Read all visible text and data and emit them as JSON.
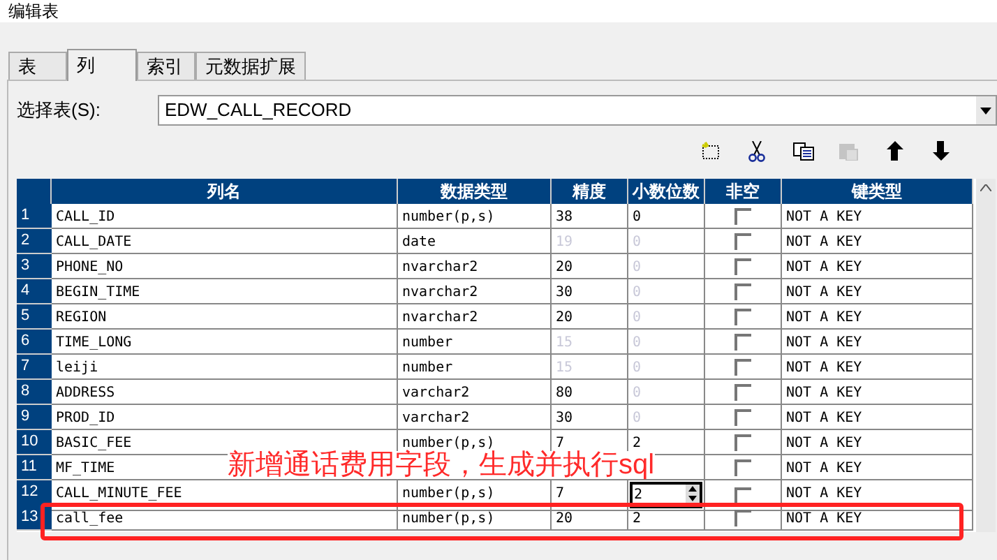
{
  "window": {
    "title": "编辑表"
  },
  "tabs": [
    {
      "label": "表",
      "selected": false
    },
    {
      "label": "列",
      "selected": true
    },
    {
      "label": "索引",
      "selected": false
    },
    {
      "label": "元数据扩展",
      "selected": false
    }
  ],
  "table_select": {
    "label": "选择表(S):",
    "value": "EDW_CALL_RECORD"
  },
  "table": {
    "columns": [
      "列名",
      "数据类型",
      "精度",
      "小数位数",
      "非空",
      "键类型"
    ],
    "rows": [
      {
        "num": "1",
        "name": "CALL_ID",
        "type": "number(p,s)",
        "precision": {
          "text": "38",
          "disabled": false
        },
        "scale": {
          "text": "0",
          "disabled": false,
          "editing": false
        },
        "not_null": false,
        "key": "NOT A KEY"
      },
      {
        "num": "2",
        "name": "CALL_DATE",
        "type": "date",
        "precision": {
          "text": "19",
          "disabled": true
        },
        "scale": {
          "text": "0",
          "disabled": true,
          "editing": false
        },
        "not_null": false,
        "key": "NOT A KEY"
      },
      {
        "num": "3",
        "name": "PHONE_NO",
        "type": "nvarchar2",
        "precision": {
          "text": "20",
          "disabled": false
        },
        "scale": {
          "text": "0",
          "disabled": true,
          "editing": false
        },
        "not_null": false,
        "key": "NOT A KEY"
      },
      {
        "num": "4",
        "name": "BEGIN_TIME",
        "type": "nvarchar2",
        "precision": {
          "text": "30",
          "disabled": false
        },
        "scale": {
          "text": "0",
          "disabled": true,
          "editing": false
        },
        "not_null": false,
        "key": "NOT A KEY"
      },
      {
        "num": "5",
        "name": "REGION",
        "type": "nvarchar2",
        "precision": {
          "text": "20",
          "disabled": false
        },
        "scale": {
          "text": "0",
          "disabled": true,
          "editing": false
        },
        "not_null": false,
        "key": "NOT A KEY"
      },
      {
        "num": "6",
        "name": "TIME_LONG",
        "type": "number",
        "precision": {
          "text": "15",
          "disabled": true
        },
        "scale": {
          "text": "0",
          "disabled": true,
          "editing": false
        },
        "not_null": false,
        "key": "NOT A KEY"
      },
      {
        "num": "7",
        "name": "leiji",
        "type": "number",
        "precision": {
          "text": "15",
          "disabled": true
        },
        "scale": {
          "text": "0",
          "disabled": true,
          "editing": false
        },
        "not_null": false,
        "key": "NOT A KEY"
      },
      {
        "num": "8",
        "name": "ADDRESS",
        "type": "varchar2",
        "precision": {
          "text": "80",
          "disabled": false
        },
        "scale": {
          "text": "0",
          "disabled": true,
          "editing": false
        },
        "not_null": false,
        "key": "NOT A KEY"
      },
      {
        "num": "9",
        "name": "PROD_ID",
        "type": "varchar2",
        "precision": {
          "text": "30",
          "disabled": false
        },
        "scale": {
          "text": "0",
          "disabled": true,
          "editing": false
        },
        "not_null": false,
        "key": "NOT A KEY"
      },
      {
        "num": "10",
        "name": "BASIC_FEE",
        "type": "number(p,s)",
        "precision": {
          "text": "7",
          "disabled": false
        },
        "scale": {
          "text": "2",
          "disabled": false,
          "editing": false
        },
        "not_null": false,
        "key": "NOT A KEY"
      },
      {
        "num": "11",
        "name": "MF_TIME",
        "not_null": false,
        "key": "NOT A KEY"
      },
      {
        "num": "12",
        "name": "CALL_MINUTE_FEE",
        "type": "number(p,s)",
        "precision": {
          "text": "7",
          "disabled": false
        },
        "scale": {
          "text": "2",
          "disabled": false,
          "editing": true
        },
        "not_null": false,
        "key": "NOT A KEY"
      },
      {
        "num": "13",
        "name": "call_fee",
        "type": "number(p,s)",
        "precision": {
          "text": "20",
          "disabled": false
        },
        "scale": {
          "text": "2",
          "disabled": false,
          "editing": false
        },
        "not_null": false,
        "key": "NOT A KEY",
        "highlighted": true
      }
    ]
  },
  "annotation": {
    "text": "新增通话费用字段，生成并执行sql"
  }
}
